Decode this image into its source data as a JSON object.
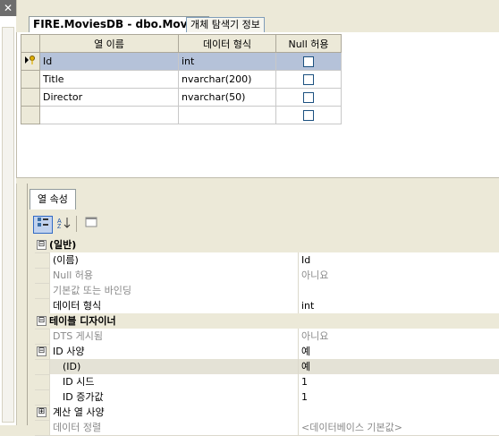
{
  "tabs": [
    {
      "label": "FIRE.MoviesDB - dbo.Movies"
    },
    {
      "label": "개체 탐색기 정보"
    }
  ],
  "left_close_glyph": "✕",
  "table": {
    "headers": [
      "열 이름",
      "데이터 형식",
      "Null 허용"
    ],
    "rows": [
      {
        "name": "Id",
        "type": "int",
        "null_allowed": false,
        "key": true,
        "current": true
      },
      {
        "name": "Title",
        "type": "nvarchar(200)",
        "null_allowed": false,
        "key": false,
        "current": false
      },
      {
        "name": "Director",
        "type": "nvarchar(50)",
        "null_allowed": false,
        "key": false,
        "current": false
      },
      {
        "name": "",
        "type": "",
        "null_allowed": false,
        "key": false,
        "current": false
      }
    ]
  },
  "props": {
    "tab_label": "열 속성",
    "toolbar": {
      "categorized_icon": "categorized-icon",
      "sort_icon": "sort-az-icon",
      "pages_icon": "property-pages-icon"
    },
    "rows": [
      {
        "kind": "cat",
        "toggle": "⊟",
        "label": "(일반)"
      },
      {
        "kind": "prop",
        "name": "(이름)",
        "value": "Id",
        "gray": false,
        "sub": false
      },
      {
        "kind": "prop",
        "name": "Null 허용",
        "value": "아니요",
        "gray": true,
        "sub": false
      },
      {
        "kind": "prop",
        "name": "기본값 또는 바인딩",
        "value": "",
        "gray": true,
        "sub": false
      },
      {
        "kind": "prop",
        "name": "데이터 형식",
        "value": "int",
        "gray": false,
        "sub": false
      },
      {
        "kind": "cat",
        "toggle": "⊟",
        "label": "테이블 디자이너"
      },
      {
        "kind": "prop",
        "name": "DTS 게시됨",
        "value": "아니요",
        "gray": true,
        "sub": false
      },
      {
        "kind": "expand",
        "toggle": "⊟",
        "name": "ID 사양",
        "value": "예",
        "gray": false
      },
      {
        "kind": "prop",
        "name": "(ID)",
        "value": "예",
        "gray": false,
        "sub": true,
        "highlight": true
      },
      {
        "kind": "prop",
        "name": "ID 시드",
        "value": "1",
        "gray": false,
        "sub": true
      },
      {
        "kind": "prop",
        "name": "ID 증가값",
        "value": "1",
        "gray": false,
        "sub": true
      },
      {
        "kind": "expand",
        "toggle": "⊞",
        "name": "계산 열 사양",
        "value": "",
        "gray": false
      },
      {
        "kind": "prop",
        "name": "데이터 정렬",
        "value": "<데이터베이스 기본값>",
        "gray": true,
        "sub": false
      }
    ]
  }
}
